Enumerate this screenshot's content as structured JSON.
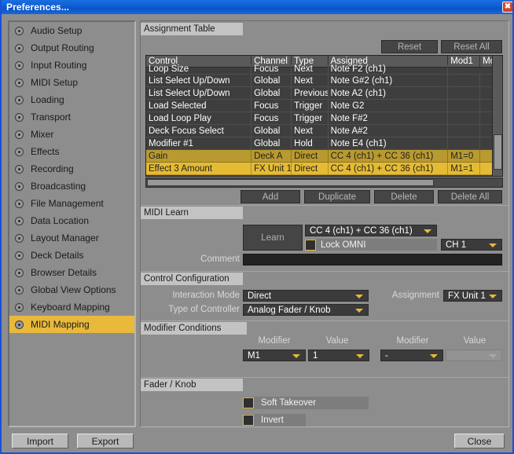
{
  "window": {
    "title": "Preferences...",
    "close_icon": "close-icon"
  },
  "sidebar": {
    "items": [
      {
        "label": "Audio Setup",
        "selected": false
      },
      {
        "label": "Output Routing",
        "selected": false
      },
      {
        "label": "Input Routing",
        "selected": false
      },
      {
        "label": "MIDI Setup",
        "selected": false
      },
      {
        "label": "Loading",
        "selected": false
      },
      {
        "label": "Transport",
        "selected": false
      },
      {
        "label": "Mixer",
        "selected": false
      },
      {
        "label": "Effects",
        "selected": false
      },
      {
        "label": "Recording",
        "selected": false
      },
      {
        "label": "Broadcasting",
        "selected": false
      },
      {
        "label": "File Management",
        "selected": false
      },
      {
        "label": "Data Location",
        "selected": false
      },
      {
        "label": "Layout Manager",
        "selected": false
      },
      {
        "label": "Deck Details",
        "selected": false
      },
      {
        "label": "Browser Details",
        "selected": false
      },
      {
        "label": "Global View Options",
        "selected": false
      },
      {
        "label": "Keyboard Mapping",
        "selected": false
      },
      {
        "label": "MIDI Mapping",
        "selected": true
      }
    ]
  },
  "footer": {
    "import_label": "Import",
    "export_label": "Export",
    "close_label": "Close"
  },
  "assignment_table": {
    "section_title": "Assignment Table",
    "reset_label": "Reset",
    "reset_all_label": "Reset All",
    "columns": [
      "Control",
      "Channel",
      "Type",
      "Assigned",
      "Mod1",
      "Mo"
    ],
    "rows": [
      {
        "control": "Loop Size",
        "channel": "Focus",
        "type": "Next",
        "assigned": "Note F2 (ch1)",
        "mod1": "",
        "mod2": "",
        "highlight": "none",
        "clipped": true
      },
      {
        "control": "List Select Up/Down",
        "channel": "Global",
        "type": "Next",
        "assigned": "Note G#2 (ch1)",
        "mod1": "",
        "mod2": "",
        "highlight": "none",
        "clipped": false
      },
      {
        "control": "List Select Up/Down",
        "channel": "Global",
        "type": "Previous",
        "assigned": "Note A2 (ch1)",
        "mod1": "",
        "mod2": "",
        "highlight": "none",
        "clipped": false
      },
      {
        "control": "Load Selected",
        "channel": "Focus",
        "type": "Trigger",
        "assigned": "Note G2",
        "mod1": "",
        "mod2": "",
        "highlight": "none",
        "clipped": false
      },
      {
        "control": "Load Loop Play",
        "channel": "Focus",
        "type": "Trigger",
        "assigned": "Note F#2",
        "mod1": "",
        "mod2": "",
        "highlight": "none",
        "clipped": false
      },
      {
        "control": "Deck Focus Select",
        "channel": "Global",
        "type": "Next",
        "assigned": "Note A#2",
        "mod1": "",
        "mod2": "",
        "highlight": "none",
        "clipped": false
      },
      {
        "control": "Modifier #1",
        "channel": "Global",
        "type": "Hold",
        "assigned": "Note E4 (ch1)",
        "mod1": "",
        "mod2": "",
        "highlight": "none",
        "clipped": false
      },
      {
        "control": "Gain",
        "channel": "Deck A",
        "type": "Direct",
        "assigned": "CC 4 (ch1) + CC 36 (ch1)",
        "mod1": "M1=0",
        "mod2": "",
        "highlight": "dim",
        "clipped": false
      },
      {
        "control": "Effect 3 Amount",
        "channel": "FX Unit 1",
        "type": "Direct",
        "assigned": "CC 4 (ch1) + CC 36 (ch1)",
        "mod1": "M1=1",
        "mod2": "",
        "highlight": "bright",
        "clipped": false
      }
    ],
    "buttons": {
      "add": "Add",
      "duplicate": "Duplicate",
      "delete": "Delete",
      "delete_all": "Delete All"
    }
  },
  "midi_learn": {
    "section_title": "MIDI Learn",
    "learn_label": "Learn",
    "assigned_value": "CC 4 (ch1) + CC 36 (ch1)",
    "lock_omni_label": "Lock OMNI",
    "lock_omni_checked": false,
    "channel_value": "CH 1",
    "comment_label": "Comment",
    "comment_value": "",
    "comment_placeholder": ""
  },
  "control_configuration": {
    "section_title": "Control Configuration",
    "interaction_mode_label": "Interaction Mode",
    "interaction_mode_value": "Direct",
    "type_of_controller_label": "Type of Controller",
    "type_of_controller_value": "Analog Fader / Knob",
    "assignment_label": "Assignment",
    "assignment_value": "FX Unit 1"
  },
  "modifier_conditions": {
    "section_title": "Modifier Conditions",
    "modifier_header_1": "Modifier",
    "value_header_1": "Value",
    "modifier_header_2": "Modifier",
    "value_header_2": "Value",
    "modifier_1_value": "M1",
    "value_1_value": "1",
    "modifier_2_value": "-",
    "value_2_value": ""
  },
  "fader_knob": {
    "section_title": "Fader / Knob",
    "soft_takeover_label": "Soft Takeover",
    "soft_takeover_checked": false,
    "invert_label": "Invert",
    "invert_checked": false
  },
  "colors": {
    "accent_gold": "#e8b93a",
    "row_highlight_dim": "#b99a30",
    "row_highlight_bright": "#e5bb34",
    "titlebar_blue": "#0f5fd6",
    "panel_gray": "#8d8d8d",
    "dark_field": "#3b3b3b"
  }
}
